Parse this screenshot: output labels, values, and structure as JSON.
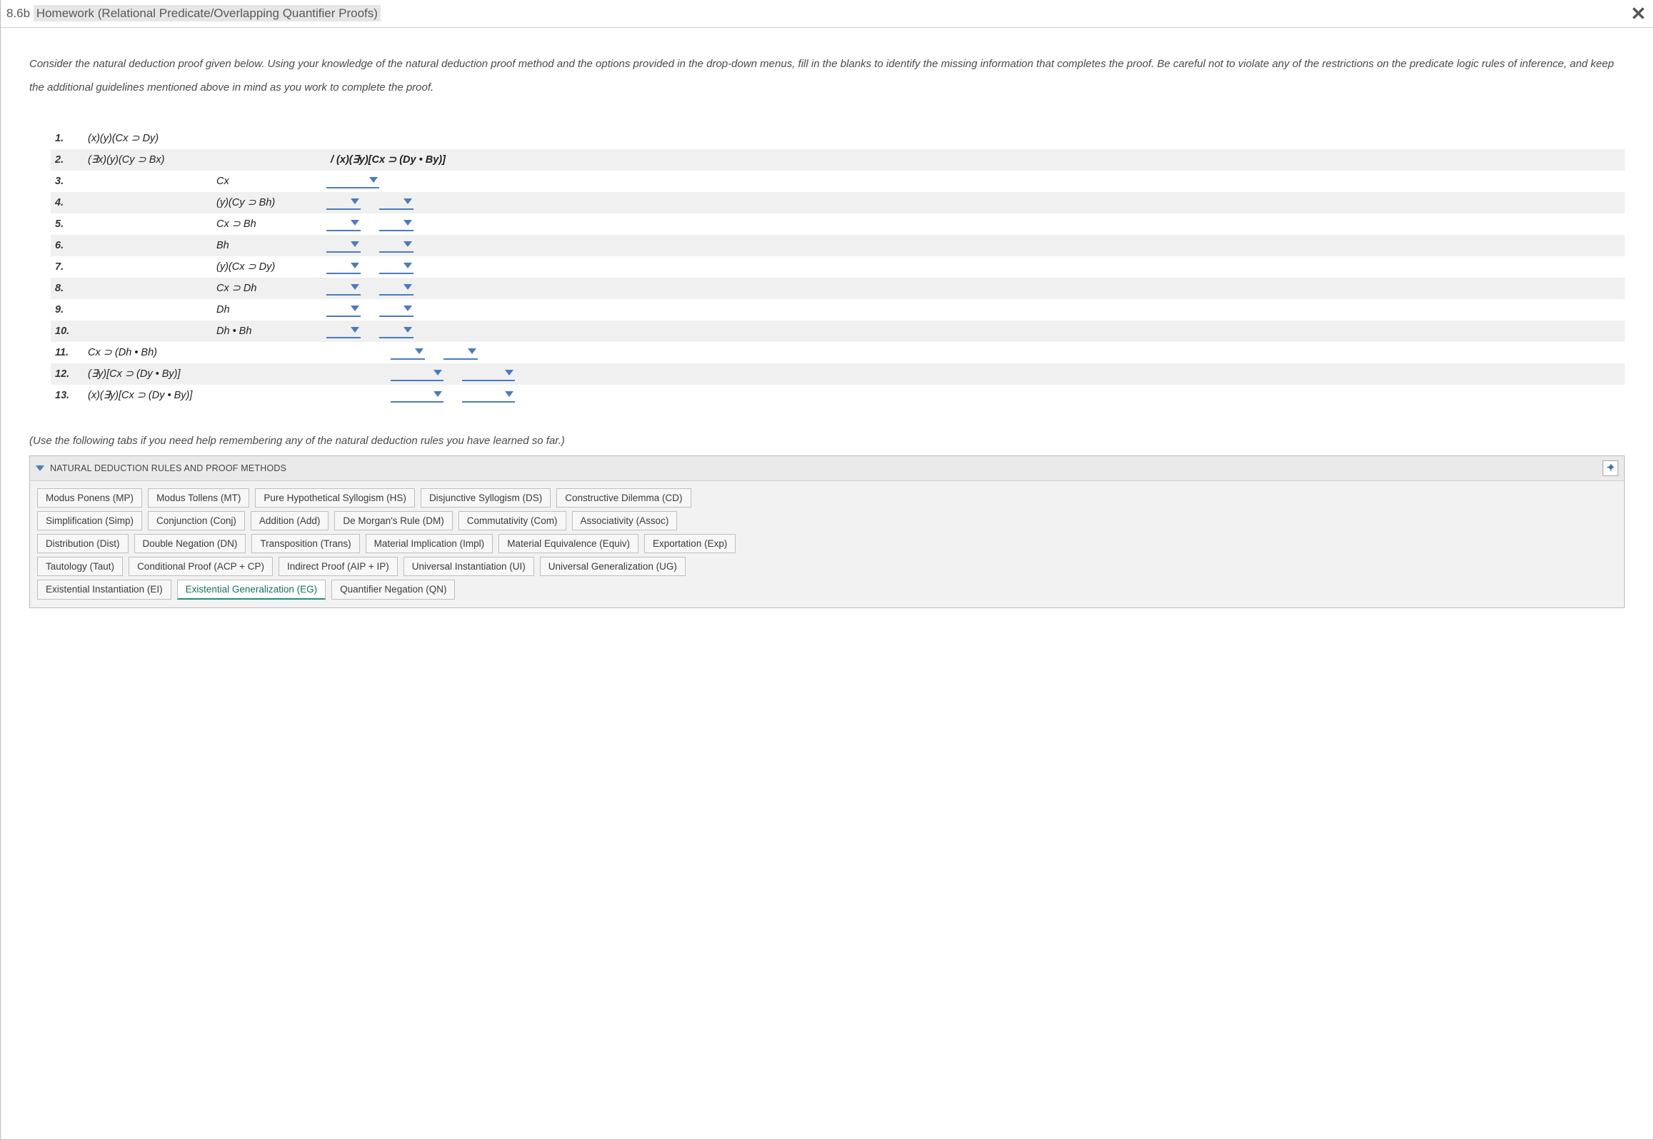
{
  "header": {
    "prefix": "8.6b ",
    "highlighted": "Homework (Relational Predicate/Overlapping Quantifier Proofs)"
  },
  "instructions": "Consider the natural deduction proof given below. Using your knowledge of the natural deduction proof method and the options provided in the drop-down menus, fill in the blanks to identify the missing information that completes the proof. Be careful not to violate any of the restrictions on the predicate logic rules of inference, and keep the additional guidelines mentioned above in mind as you work to complete the proof.",
  "proof": {
    "rows": [
      {
        "n": "1.",
        "colA": "(x)(y)(Cx ⊃ Dy)",
        "colB": "",
        "layout": "A",
        "dd": "none",
        "shaded": false
      },
      {
        "n": "2.",
        "colA": "(∃x)(y)(Cy ⊃ Bx)",
        "colB": "",
        "layout": "A",
        "dd": "none",
        "shaded": true,
        "conclusion": "/ (x)(∃y)[Cx ⊃ (Dy • By)]"
      },
      {
        "n": "3.",
        "colA": "",
        "colB": "Cx",
        "layout": "B",
        "dd": "one_wide",
        "shaded": false
      },
      {
        "n": "4.",
        "colA": "",
        "colB": "(y)(Cy ⊃ Bh)",
        "layout": "B",
        "dd": "two",
        "shaded": true
      },
      {
        "n": "5.",
        "colA": "",
        "colB": "Cx ⊃ Bh",
        "layout": "B",
        "dd": "two",
        "shaded": false
      },
      {
        "n": "6.",
        "colA": "",
        "colB": "Bh",
        "layout": "B",
        "dd": "two",
        "shaded": true
      },
      {
        "n": "7.",
        "colA": "",
        "colB": "(y)(Cx ⊃ Dy)",
        "layout": "B",
        "dd": "two",
        "shaded": false
      },
      {
        "n": "8.",
        "colA": "",
        "colB": "Cx ⊃ Dh",
        "layout": "B",
        "dd": "two",
        "shaded": true
      },
      {
        "n": "9.",
        "colA": "",
        "colB": "Dh",
        "layout": "B",
        "dd": "two",
        "shaded": false
      },
      {
        "n": "10.",
        "colA": "",
        "colB": "Dh • Bh",
        "layout": "B",
        "dd": "two",
        "shaded": true
      },
      {
        "n": "11.",
        "colA": "Cx ⊃ (Dh • Bh)",
        "colB": "",
        "layout": "A",
        "dd": "two",
        "shaded": false,
        "ddOffset": "off1"
      },
      {
        "n": "12.",
        "colA": "(∃y)[Cx ⊃ (Dy • By)]",
        "colB": "",
        "layout": "A",
        "dd": "two_wide",
        "shaded": true,
        "ddOffset": "off1"
      },
      {
        "n": "13.",
        "colA": "(x)(∃y)[Cx ⊃ (Dy • By)]",
        "colB": "",
        "layout": "A",
        "dd": "two_wide",
        "shaded": false,
        "ddOffset": "off1"
      }
    ]
  },
  "hint": "(Use the following tabs if you need help remembering any of the natural deduction rules you have learned so far.)",
  "rules": {
    "title": "NATURAL DEDUCTION RULES AND PROOF METHODS",
    "rows": [
      [
        "Modus Ponens (MP)",
        "Modus Tollens (MT)",
        "Pure Hypothetical Syllogism (HS)",
        "Disjunctive Syllogism (DS)",
        "Constructive Dilemma (CD)"
      ],
      [
        "Simplification (Simp)",
        "Conjunction (Conj)",
        "Addition (Add)",
        "De Morgan's Rule (DM)",
        "Commutativity (Com)",
        "Associativity (Assoc)"
      ],
      [
        "Distribution (Dist)",
        "Double Negation (DN)",
        "Transposition (Trans)",
        "Material Implication (Impl)",
        "Material Equivalence (Equiv)",
        "Exportation (Exp)"
      ],
      [
        "Tautology (Taut)",
        "Conditional Proof (ACP + CP)",
        "Indirect Proof (AIP + IP)",
        "Universal Instantiation (UI)",
        "Universal Generalization (UG)"
      ],
      [
        "Existential Instantiation (EI)",
        "Existential Generalization (EG)",
        "Quantifier Negation (QN)"
      ]
    ],
    "active": "Existential Generalization (EG)"
  }
}
